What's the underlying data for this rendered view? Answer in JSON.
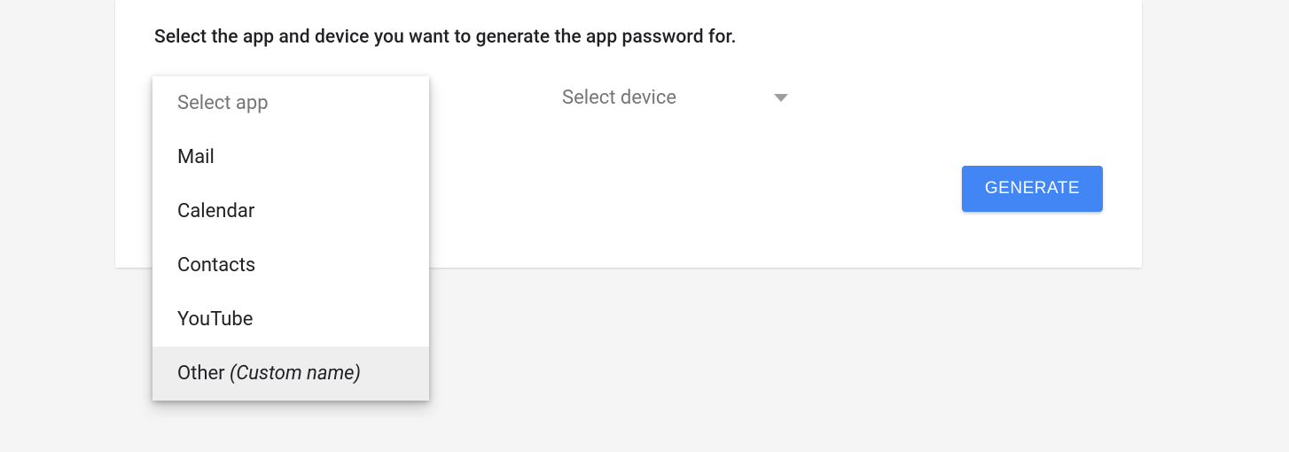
{
  "instruction": "Select the app and device you want to generate the app password for.",
  "select_app": {
    "label": "Select app",
    "options": [
      {
        "label": "Mail"
      },
      {
        "label": "Calendar"
      },
      {
        "label": "Contacts"
      },
      {
        "label": "YouTube"
      },
      {
        "label": "Other ",
        "suffix_italic": "(Custom name)",
        "highlight": true
      }
    ]
  },
  "select_device": {
    "label": "Select device"
  },
  "generate_button": "GENERATE"
}
